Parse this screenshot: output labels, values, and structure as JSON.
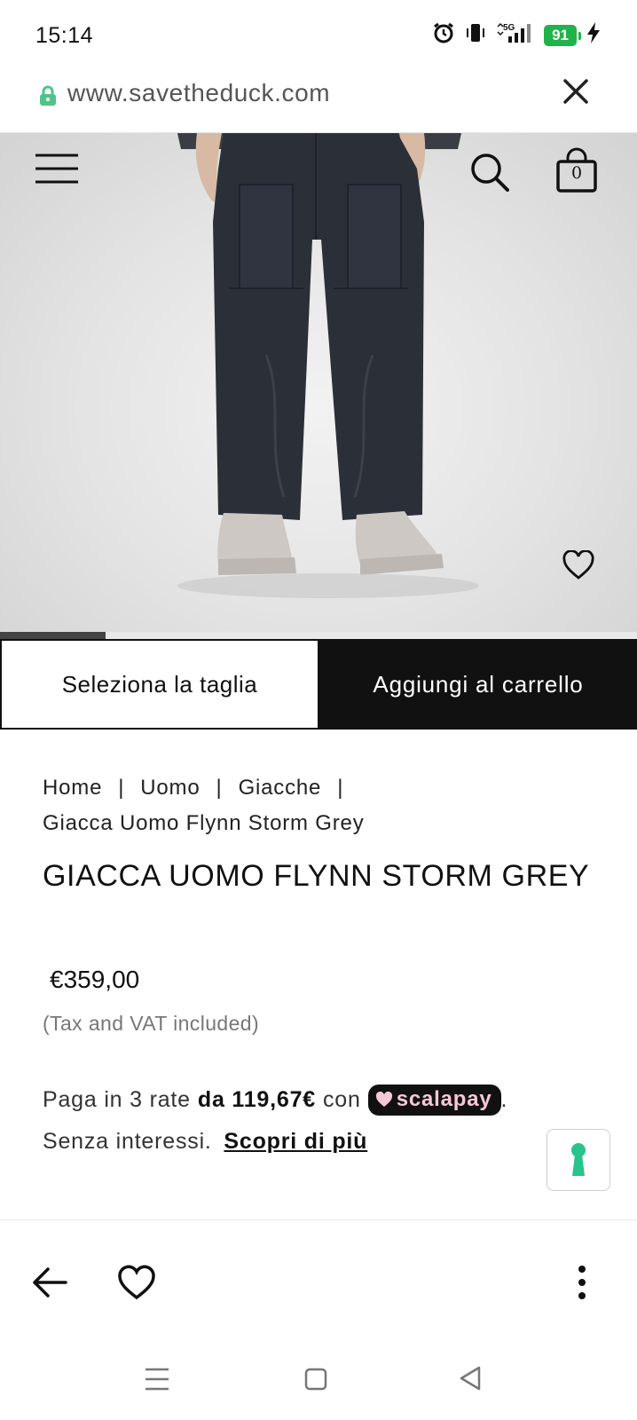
{
  "status_bar": {
    "time": "15:14",
    "network": "5G",
    "battery": "91"
  },
  "browser": {
    "url": "www.savetheduck.com"
  },
  "header": {
    "cart_count": "0"
  },
  "carousel": {
    "progress": 0.166
  },
  "actions": {
    "select_size": "Seleziona la taglia",
    "add_to_cart": "Aggiungi al carrello"
  },
  "breadcrumb": {
    "home": "Home",
    "uomo": "Uomo",
    "giacche": "Giacche",
    "current": "Giacca Uomo Flynn Storm Grey",
    "separator": "|"
  },
  "product": {
    "title": "GIACCA UOMO FLYNN STORM GREY",
    "price": "€359,00",
    "tax_note": "(Tax and VAT included)"
  },
  "installments": {
    "prefix": "Paga in 3 rate",
    "amount": "da 119,67€",
    "connector": "con",
    "brand": "scalapay",
    "period": ".",
    "no_interest": "Senza interessi.",
    "learn_more": "Scopri di più"
  },
  "colors": {
    "accent": "#111111",
    "lock_green": "#22b24c",
    "scalapay_pink": "#f6c7d8",
    "keyhole_teal": "#27c48c"
  }
}
